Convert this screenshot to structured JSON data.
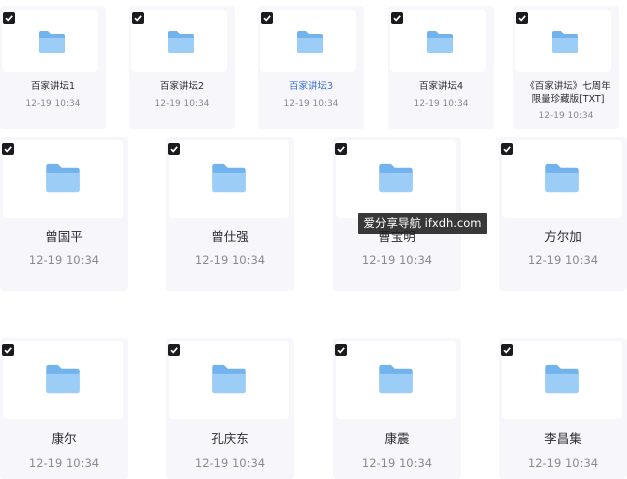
{
  "colors": {
    "card_bg": "#f7f6fb",
    "thumb_bg": "#ffffff",
    "folder_back": "#72b3ee",
    "folder_front": "#9ccdf7",
    "checkbox": "#1b1b1f",
    "link_blue": "#3a6fd6"
  },
  "icons": {
    "folder": "folder-icon",
    "checkbox": "checkbox-checked-icon"
  },
  "files": [
    {
      "name": "百家讲坛1",
      "date": "12-19 10:34",
      "checked": true
    },
    {
      "name": "百家讲坛2",
      "date": "12-19 10:34",
      "checked": true
    },
    {
      "name": "百家讲坛3",
      "date": "12-19 10:34",
      "checked": true,
      "highlighted": true
    },
    {
      "name": "百家讲坛4",
      "date": "12-19 10:34",
      "checked": true
    },
    {
      "name": "《百家讲坛》七周年限量珍藏版[TXT]",
      "date": "12-19 10:34",
      "checked": true
    },
    {
      "name": "曾国平",
      "date": "12-19 10:34",
      "checked": true
    },
    {
      "name": "曾仕强",
      "date": "12-19 10:34",
      "checked": true
    },
    {
      "name": "曹宝明",
      "date": "12-19 10:34",
      "checked": true
    },
    {
      "name": "方尔加",
      "date": "12-19 10:34",
      "checked": true
    },
    {
      "name": "康尔",
      "date": "12-19 10:34",
      "checked": true
    },
    {
      "name": "孔庆东",
      "date": "12-19 10:34",
      "checked": true
    },
    {
      "name": "康震",
      "date": "12-19 10:34",
      "checked": true
    },
    {
      "name": "李昌集",
      "date": "12-19 10:34",
      "checked": true
    }
  ],
  "watermark": "爱分享导航 ifxdh.com"
}
